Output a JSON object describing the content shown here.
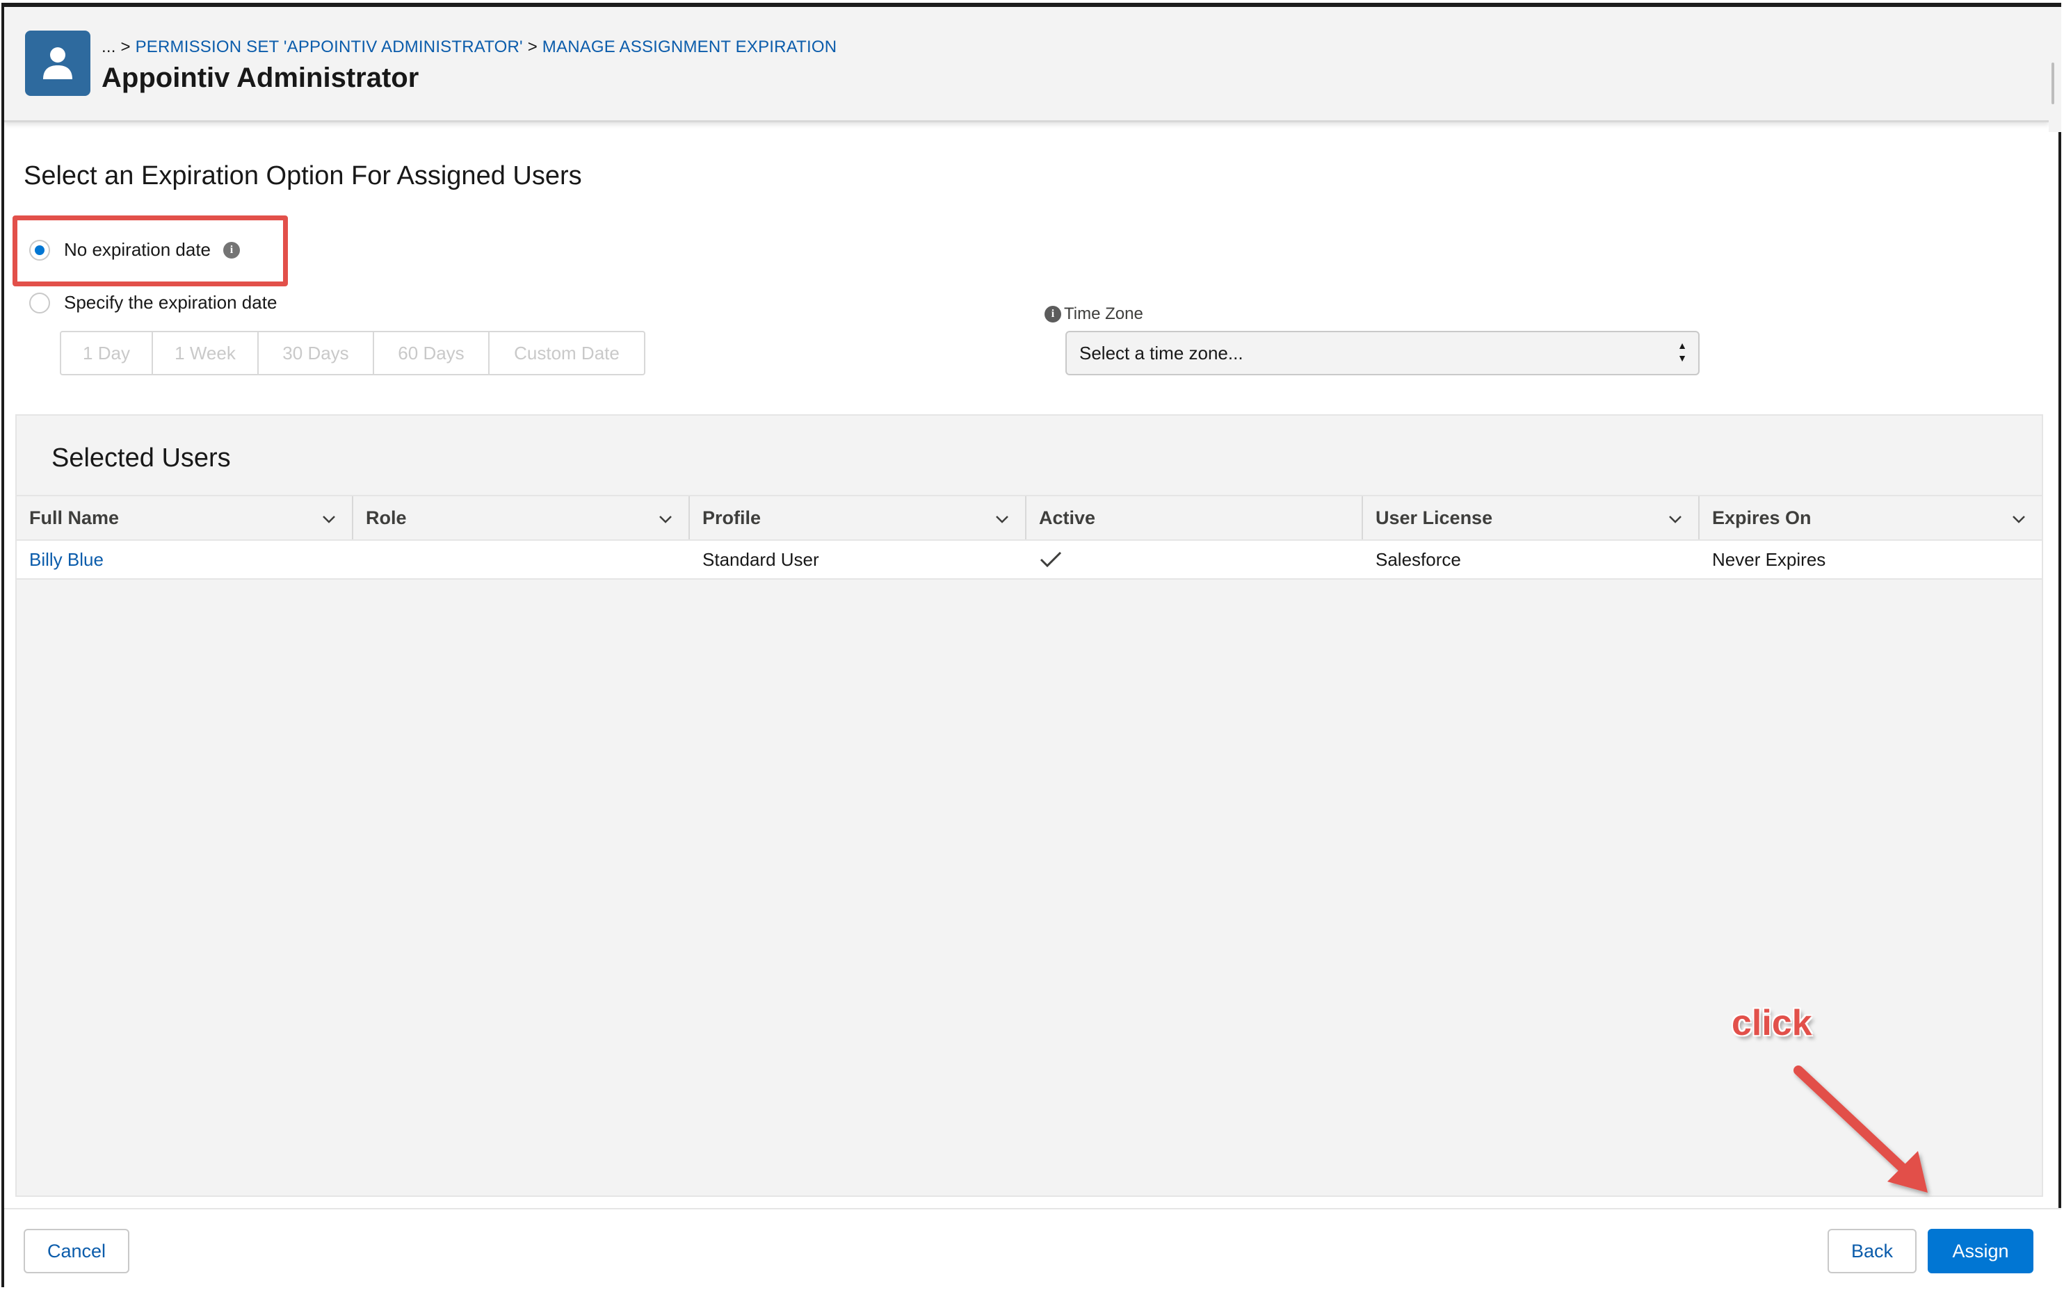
{
  "header": {
    "breadcrumb_prefix": "... >",
    "breadcrumb_item_1": "PERMISSION SET 'APPOINTIV ADMINISTRATOR'",
    "breadcrumb_separator": ">",
    "breadcrumb_item_2": "MANAGE ASSIGNMENT EXPIRATION",
    "title": "Appointiv Administrator",
    "icon": "user-icon"
  },
  "expiration": {
    "heading": "Select an Expiration Option For Assigned Users",
    "option_no_expiration": "No expiration date",
    "option_specify": "Specify the expiration date",
    "selected": "No expiration date",
    "durations": [
      "1 Day",
      "1 Week",
      "30 Days",
      "60 Days",
      "Custom Date"
    ]
  },
  "timezone": {
    "label": "Time Zone",
    "placeholder": "Select a time zone..."
  },
  "selected_users": {
    "title": "Selected Users",
    "columns": [
      "Full Name",
      "Role",
      "Profile",
      "Active",
      "User License",
      "Expires On"
    ],
    "rows": [
      {
        "full_name": "Billy Blue",
        "role": "",
        "profile": "Standard User",
        "active": true,
        "user_license": "Salesforce",
        "expires_on": "Never Expires"
      }
    ]
  },
  "footer": {
    "cancel_label": "Cancel",
    "back_label": "Back",
    "assign_label": "Assign"
  },
  "annotation": {
    "text": "click",
    "color": "#e2504a"
  },
  "colors": {
    "brand": "#0176d3",
    "link": "#0b5cab",
    "avatar": "#2e6a9e",
    "highlight": "#e2504a"
  }
}
